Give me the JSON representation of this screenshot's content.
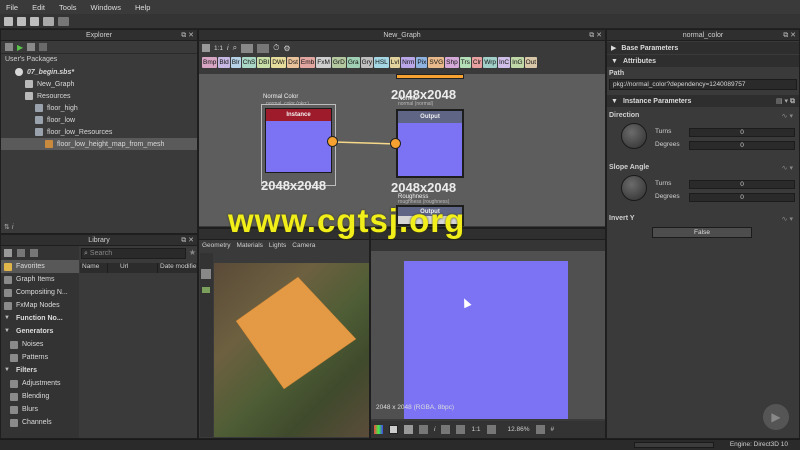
{
  "menu": [
    "File",
    "Edit",
    "Tools",
    "Windows",
    "Help"
  ],
  "explorer": {
    "title": "Explorer",
    "section": "User's Packages",
    "package": "07_begin.sbs*",
    "items": [
      {
        "label": "New_Graph",
        "indent": 1
      },
      {
        "label": "Resources",
        "indent": 1
      },
      {
        "label": "floor_high",
        "indent": 2
      },
      {
        "label": "floor_low",
        "indent": 2
      },
      {
        "label": "floor_low_Resources",
        "indent": 2
      },
      {
        "label": "floor_low_height_map_from_mesh",
        "indent": 3,
        "selected": true
      }
    ]
  },
  "library": {
    "title": "Library",
    "search_placeholder": "Search",
    "columns": [
      "Name",
      "Url",
      "Date modifie"
    ],
    "categories": [
      {
        "label": "Favorites",
        "type": "item",
        "selected": true
      },
      {
        "label": "Graph Items",
        "type": "item"
      },
      {
        "label": "Compositing N...",
        "type": "item"
      },
      {
        "label": "FxMap Nodes",
        "type": "item"
      },
      {
        "label": "Function No...",
        "type": "head"
      },
      {
        "label": "Generators",
        "type": "head"
      },
      {
        "label": "Noises",
        "type": "sub"
      },
      {
        "label": "Patterns",
        "type": "sub"
      },
      {
        "label": "Filters",
        "type": "head"
      },
      {
        "label": "Adjustments",
        "type": "sub"
      },
      {
        "label": "Blending",
        "type": "sub"
      },
      {
        "label": "Blurs",
        "type": "sub"
      },
      {
        "label": "Channels",
        "type": "sub"
      }
    ]
  },
  "graph": {
    "title": "New_Graph",
    "zoom_label": "1:1",
    "filters": [
      "Bmp",
      "Bld",
      "Blr",
      "ChS",
      "DBI",
      "DWr",
      "Dst",
      "Emb",
      "FxM",
      "GrD",
      "Gra",
      "Gry",
      "HSL",
      "Lvl",
      "Nrm",
      "Pix",
      "SVG",
      "Shp",
      "Trs",
      "Clr",
      "Wrp",
      "InC",
      "InG",
      "Out"
    ],
    "nodes": {
      "normal_color": {
        "label": "Normal Color",
        "sublabel": "normal_color (pkg:)",
        "header": "Instance",
        "res": "2048x2048"
      },
      "normal": {
        "label": "Normal",
        "sublabel": "normal (normal)",
        "header": "Output",
        "res": "2048x2048"
      },
      "top_res": "2048x2048",
      "roughness": {
        "label": "Roughness",
        "sublabel": "roughness (roughness)",
        "header": "Output"
      }
    }
  },
  "viewport3d": {
    "menus": [
      "Geometry",
      "Materials",
      "Lights",
      "Camera"
    ]
  },
  "viewport2d": {
    "info": "2048 x 2048 (RGBA, 8bpc)",
    "zoom": "12.86%",
    "ratio": "1:1"
  },
  "params": {
    "title": "normal_color",
    "sections": {
      "base": "Base Parameters",
      "attributes": "Attributes",
      "instance": "Instance Parameters"
    },
    "path_label": "Path",
    "path_value": "pkg://normal_color?dependency=1240089757",
    "direction": {
      "label": "Direction",
      "turns_label": "Turns",
      "turns": "0",
      "degrees_label": "Degrees",
      "degrees": "0"
    },
    "slope": {
      "label": "Slope Angle",
      "turns_label": "Turns",
      "turns": "0",
      "degrees_label": "Degrees",
      "degrees": "0"
    },
    "invert_y": {
      "label": "Invert Y",
      "value": "False"
    }
  },
  "statusbar": {
    "engine": "Engine: Direct3D 10"
  },
  "watermark": "www.cgtsj.org",
  "colors": {
    "normal_blue": "#7b73f4",
    "node_orange": "#f6a130",
    "instance_red": "#9e1b2b",
    "output_gray": "#5f6585",
    "watermark": "#f1ee1a"
  }
}
